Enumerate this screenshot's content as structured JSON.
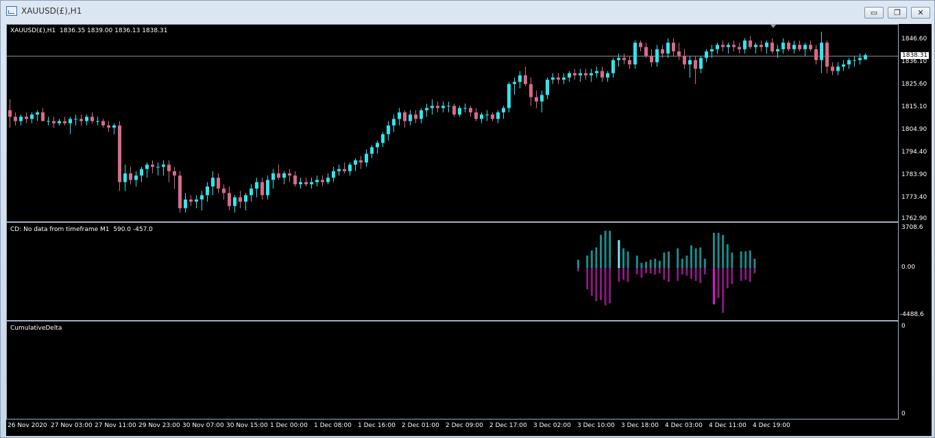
{
  "window": {
    "title": "XAUUSD(£),H1",
    "buttons": {
      "minimize": "▭",
      "restore": "❐",
      "close": "✕"
    }
  },
  "main_pane": {
    "header": "XAUUSD(£),H1  1836.35 1839.00 1836.13 1838.31",
    "current_price": "1838.31",
    "price_labels": [
      "1846.60",
      "1836.10",
      "1825.60",
      "1815.10",
      "1804.90",
      "1794.40",
      "1783.90",
      "1773.40",
      "1762.90"
    ]
  },
  "cd_pane": {
    "header": "CD: No data from timeframe M1  590.0 -457.0",
    "labels": [
      "3708.6",
      "0.00",
      "-4488.6"
    ]
  },
  "cum_pane": {
    "header": "CumulativeDelta",
    "labels": [
      "0",
      "0"
    ]
  },
  "time_labels": [
    "26 Nov 2020",
    "27 Nov 03:00",
    "27 Nov 11:00",
    "29 Nov 23:00",
    "30 Nov 07:00",
    "30 Nov 15:00",
    "1 Dec 00:00",
    "1 Dec 08:00",
    "1 Dec 16:00",
    "2 Dec 01:00",
    "2 Dec 09:00",
    "2 Dec 17:00",
    "3 Dec 02:00",
    "3 Dec 10:00",
    "3 Dec 18:00",
    "4 Dec 03:00",
    "4 Dec 11:00",
    "4 Dec 19:00"
  ],
  "colors": {
    "bull": "#2ee6ee",
    "bear": "#d86a8a",
    "pos_hist": "#1a8c8c",
    "neg_hist": "#8a1a7e",
    "neg_hist_highlight": "#e010d0",
    "pos_hist_highlight": "#7fe8ff"
  },
  "chart_data": [
    {
      "type": "candlestick",
      "title": "XAUUSD(£),H1",
      "ylim": [
        1762.9,
        1846.6
      ],
      "candles": [
        [
          1813,
          1818,
          1805,
          1810
        ],
        [
          1810,
          1812,
          1806,
          1808
        ],
        [
          1808,
          1811,
          1806,
          1810
        ],
        [
          1810,
          1812,
          1807,
          1809
        ],
        [
          1809,
          1812,
          1807,
          1811
        ],
        [
          1811,
          1813,
          1808,
          1812
        ],
        [
          1812,
          1814,
          1808,
          1808
        ],
        [
          1808,
          1810,
          1806,
          1808
        ],
        [
          1808,
          1810,
          1805,
          1807
        ],
        [
          1807,
          1809,
          1806,
          1808
        ],
        [
          1808,
          1810,
          1806,
          1807
        ],
        [
          1807,
          1810,
          1802,
          1809
        ],
        [
          1809,
          1811,
          1806,
          1809
        ],
        [
          1809,
          1811,
          1806,
          1808
        ],
        [
          1808,
          1811,
          1806,
          1810
        ],
        [
          1810,
          1812,
          1807,
          1808
        ],
        [
          1808,
          1810,
          1806,
          1808
        ],
        [
          1808,
          1809,
          1805,
          1806
        ],
        [
          1806,
          1808,
          1803,
          1805
        ],
        [
          1805,
          1807,
          1802,
          1806
        ],
        [
          1806,
          1808,
          1776,
          1780
        ],
        [
          1780,
          1788,
          1776,
          1784
        ],
        [
          1784,
          1787,
          1779,
          1781
        ],
        [
          1781,
          1785,
          1778,
          1783
        ],
        [
          1783,
          1787,
          1780,
          1786
        ],
        [
          1786,
          1789,
          1782,
          1788
        ],
        [
          1788,
          1790,
          1784,
          1787
        ],
        [
          1787,
          1789,
          1783,
          1787
        ],
        [
          1787,
          1790,
          1783,
          1788
        ],
        [
          1788,
          1790,
          1780,
          1785
        ],
        [
          1785,
          1787,
          1777,
          1783
        ],
        [
          1783,
          1785,
          1766,
          1768
        ],
        [
          1768,
          1775,
          1766,
          1772
        ],
        [
          1772,
          1774,
          1769,
          1771
        ],
        [
          1771,
          1774,
          1768,
          1772
        ],
        [
          1772,
          1776,
          1767,
          1774
        ],
        [
          1774,
          1780,
          1771,
          1778
        ],
        [
          1778,
          1785,
          1774,
          1782
        ],
        [
          1782,
          1784,
          1775,
          1777
        ],
        [
          1777,
          1779,
          1772,
          1775
        ],
        [
          1775,
          1778,
          1767,
          1769
        ],
        [
          1769,
          1774,
          1766,
          1773
        ],
        [
          1773,
          1776,
          1768,
          1771
        ],
        [
          1771,
          1775,
          1767,
          1774
        ],
        [
          1774,
          1779,
          1771,
          1777
        ],
        [
          1777,
          1782,
          1773,
          1780
        ],
        [
          1780,
          1782,
          1772,
          1774
        ],
        [
          1774,
          1783,
          1772,
          1781
        ],
        [
          1781,
          1786,
          1777,
          1784
        ],
        [
          1784,
          1788,
          1781,
          1782
        ],
        [
          1782,
          1785,
          1779,
          1784
        ],
        [
          1784,
          1786,
          1780,
          1783
        ],
        [
          1783,
          1785,
          1778,
          1779
        ],
        [
          1779,
          1782,
          1777,
          1780
        ],
        [
          1780,
          1782,
          1778,
          1779
        ],
        [
          1779,
          1782,
          1777,
          1780
        ],
        [
          1780,
          1783,
          1778,
          1781
        ],
        [
          1781,
          1783,
          1778,
          1780
        ],
        [
          1780,
          1784,
          1779,
          1782
        ],
        [
          1782,
          1787,
          1780,
          1785
        ],
        [
          1785,
          1788,
          1783,
          1786
        ],
        [
          1786,
          1789,
          1784,
          1785
        ],
        [
          1785,
          1789,
          1783,
          1788
        ],
        [
          1788,
          1791,
          1785,
          1790
        ],
        [
          1790,
          1792,
          1786,
          1789
        ],
        [
          1789,
          1795,
          1787,
          1793
        ],
        [
          1793,
          1797,
          1791,
          1796
        ],
        [
          1796,
          1799,
          1793,
          1798
        ],
        [
          1798,
          1803,
          1796,
          1802
        ],
        [
          1802,
          1808,
          1799,
          1806
        ],
        [
          1806,
          1811,
          1803,
          1809
        ],
        [
          1809,
          1814,
          1806,
          1812
        ],
        [
          1812,
          1813,
          1805,
          1808
        ],
        [
          1808,
          1813,
          1806,
          1811
        ],
        [
          1811,
          1813,
          1807,
          1809
        ],
        [
          1809,
          1814,
          1807,
          1813
        ],
        [
          1813,
          1816,
          1810,
          1814
        ],
        [
          1814,
          1818,
          1811,
          1815
        ],
        [
          1815,
          1817,
          1812,
          1814
        ],
        [
          1814,
          1817,
          1812,
          1815
        ],
        [
          1815,
          1817,
          1812,
          1815
        ],
        [
          1815,
          1816,
          1810,
          1811
        ],
        [
          1811,
          1815,
          1810,
          1814
        ],
        [
          1814,
          1816,
          1812,
          1814
        ],
        [
          1814,
          1815,
          1810,
          1812
        ],
        [
          1812,
          1814,
          1808,
          1809
        ],
        [
          1809,
          1812,
          1807,
          1811
        ],
        [
          1811,
          1813,
          1808,
          1811
        ],
        [
          1811,
          1812,
          1808,
          1809
        ],
        [
          1809,
          1813,
          1807,
          1812
        ],
        [
          1812,
          1815,
          1809,
          1814
        ],
        [
          1814,
          1826,
          1812,
          1825
        ],
        [
          1825,
          1828,
          1820,
          1826
        ],
        [
          1826,
          1831,
          1823,
          1829
        ],
        [
          1829,
          1833,
          1824,
          1825
        ],
        [
          1825,
          1828,
          1815,
          1819
        ],
        [
          1819,
          1822,
          1814,
          1817
        ],
        [
          1817,
          1822,
          1812,
          1820
        ],
        [
          1820,
          1828,
          1818,
          1827
        ],
        [
          1827,
          1830,
          1825,
          1828
        ],
        [
          1828,
          1830,
          1825,
          1827
        ],
        [
          1827,
          1830,
          1825,
          1828
        ],
        [
          1828,
          1831,
          1826,
          1830
        ],
        [
          1830,
          1832,
          1827,
          1829
        ],
        [
          1829,
          1832,
          1826,
          1830
        ],
        [
          1830,
          1832,
          1827,
          1829
        ],
        [
          1829,
          1832,
          1826,
          1830
        ],
        [
          1830,
          1833,
          1828,
          1831
        ],
        [
          1831,
          1833,
          1826,
          1828
        ],
        [
          1828,
          1831,
          1826,
          1830
        ],
        [
          1830,
          1837,
          1828,
          1836
        ],
        [
          1836,
          1839,
          1833,
          1837
        ],
        [
          1837,
          1839,
          1834,
          1836
        ],
        [
          1836,
          1838,
          1832,
          1834
        ],
        [
          1834,
          1845,
          1832,
          1844
        ],
        [
          1844,
          1845,
          1840,
          1842
        ],
        [
          1842,
          1844,
          1837,
          1838
        ],
        [
          1838,
          1841,
          1833,
          1835
        ],
        [
          1835,
          1843,
          1833,
          1841
        ],
        [
          1841,
          1843,
          1837,
          1839
        ],
        [
          1839,
          1846,
          1837,
          1844
        ],
        [
          1844,
          1846,
          1838,
          1840
        ],
        [
          1840,
          1844,
          1836,
          1838
        ],
        [
          1838,
          1841,
          1832,
          1834
        ],
        [
          1834,
          1838,
          1828,
          1836
        ],
        [
          1836,
          1838,
          1825,
          1832
        ],
        [
          1832,
          1838,
          1830,
          1837
        ],
        [
          1837,
          1841,
          1835,
          1840
        ],
        [
          1840,
          1843,
          1837,
          1841
        ],
        [
          1841,
          1844,
          1839,
          1843
        ],
        [
          1843,
          1845,
          1840,
          1842
        ],
        [
          1842,
          1844,
          1839,
          1843
        ],
        [
          1843,
          1845,
          1840,
          1842
        ],
        [
          1842,
          1844,
          1839,
          1841
        ],
        [
          1841,
          1846,
          1839,
          1845
        ],
        [
          1845,
          1847,
          1841,
          1842
        ],
        [
          1842,
          1844,
          1839,
          1843
        ],
        [
          1843,
          1845,
          1840,
          1842
        ],
        [
          1842,
          1845,
          1839,
          1844
        ],
        [
          1844,
          1846,
          1839,
          1840
        ],
        [
          1840,
          1843,
          1837,
          1841
        ],
        [
          1841,
          1846,
          1839,
          1844
        ],
        [
          1844,
          1845,
          1840,
          1841
        ],
        [
          1841,
          1845,
          1839,
          1843
        ],
        [
          1843,
          1845,
          1840,
          1841
        ],
        [
          1841,
          1844,
          1838,
          1843
        ],
        [
          1843,
          1845,
          1840,
          1841
        ],
        [
          1841,
          1843,
          1834,
          1836
        ],
        [
          1836,
          1849,
          1830,
          1844
        ],
        [
          1844,
          1845,
          1830,
          1833
        ],
        [
          1833,
          1835,
          1829,
          1831
        ],
        [
          1831,
          1835,
          1829,
          1833
        ],
        [
          1833,
          1836,
          1831,
          1834
        ],
        [
          1834,
          1837,
          1832,
          1836
        ],
        [
          1836,
          1838,
          1833,
          1836
        ],
        [
          1836,
          1839,
          1834,
          1837
        ],
        [
          1836.35,
          1839.0,
          1836.13,
          1838.31
        ]
      ]
    },
    {
      "type": "bar",
      "title": "CD: No data from timeframe M1",
      "ylim": [
        -4488.6,
        3708.6
      ],
      "positive": [
        800,
        0,
        1200,
        1700,
        2000,
        3200,
        3600,
        3600,
        0,
        2700,
        1900,
        1600,
        0,
        1200,
        500,
        600,
        800,
        900,
        700,
        1500,
        1600,
        0,
        1900,
        900,
        1200,
        2200,
        1900,
        2000,
        900,
        0,
        3400,
        3400,
        3200,
        2300,
        1500,
        0,
        1600,
        1600,
        1700,
        900
      ],
      "negative": [
        -300,
        0,
        -2000,
        -2600,
        -3100,
        -3000,
        -3500,
        -3300,
        0,
        -1300,
        -1100,
        -1300,
        0,
        -600,
        -900,
        -500,
        -500,
        -600,
        -500,
        -1100,
        -1300,
        0,
        -1200,
        -600,
        -700,
        -1000,
        -1200,
        -1400,
        -600,
        0,
        -3400,
        -2800,
        -4200,
        -1900,
        -1500,
        0,
        -1200,
        -1100,
        -1300,
        -500
      ]
    },
    {
      "type": "line",
      "title": "CumulativeDelta",
      "ylim": [
        0,
        0
      ],
      "values": []
    }
  ]
}
